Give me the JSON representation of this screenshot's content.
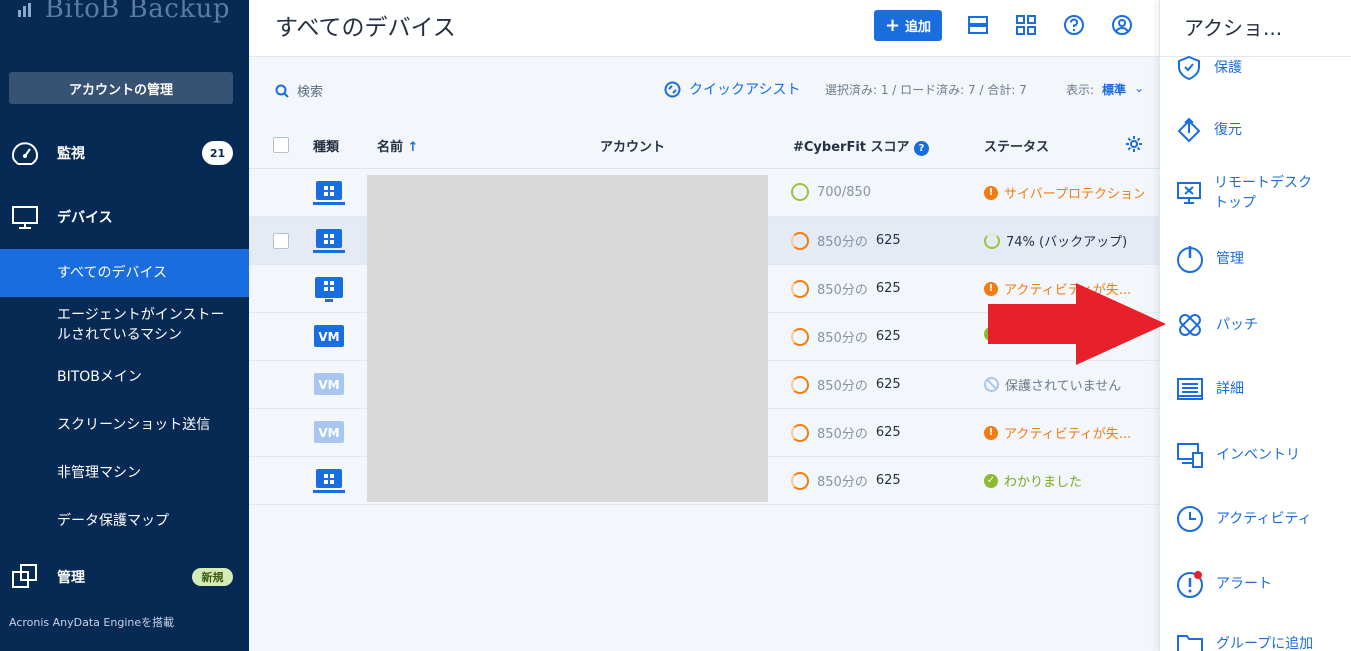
{
  "sidebar": {
    "logo": "BitoB Backup",
    "account_button": "アカウントの管理",
    "monitor": {
      "label": "監視",
      "badge": "21"
    },
    "devices": {
      "label": "デバイス"
    },
    "sub_items": [
      {
        "label": "すべてのデバイス",
        "active": true
      },
      {
        "label": "エージェントがインストールされているマシン"
      },
      {
        "label": "BITOBメイン"
      },
      {
        "label": "スクリーンショット送信"
      },
      {
        "label": "非管理マシン"
      },
      {
        "label": "データ保護マップ"
      }
    ],
    "management": {
      "label": "管理",
      "badge": "新規"
    },
    "footer": "Acronis AnyData Engineを搭載"
  },
  "header": {
    "title": "すべてのデバイス",
    "add_label": "追加"
  },
  "toolbar": {
    "search_label": "検索",
    "quick_assist": "クイックアシスト",
    "selection_info": "選択済み: 1 / ロード済み: 7 / 合計: 7",
    "view_label": "表示:",
    "view_value": "標準"
  },
  "table": {
    "headers": {
      "type": "種類",
      "name": "名前",
      "account": "アカウント",
      "score": "#CyberFit スコア",
      "status": "ステータス"
    },
    "rows": [
      {
        "type": "pc",
        "score_prefix": "700/850",
        "score_value": "",
        "status": "サイバープロテクション...",
        "status_kind": "warning"
      },
      {
        "type": "pc",
        "score_prefix": "850分の",
        "score_value": "625",
        "status": "74% (バックアップ)",
        "status_kind": "progress",
        "selected": true
      },
      {
        "type": "server",
        "score_prefix": "850分の",
        "score_value": "625",
        "status": "アクティビティが失...",
        "status_kind": "warning"
      },
      {
        "type": "vm",
        "score_prefix": "850分の",
        "score_value": "625",
        "status": "",
        "status_kind": "ok-hidden"
      },
      {
        "type": "vm-faded",
        "score_prefix": "850分の",
        "score_value": "625",
        "status": "保護されていません",
        "status_kind": "none"
      },
      {
        "type": "vm-faded",
        "score_prefix": "850分の",
        "score_value": "625",
        "status": "アクティビティが失...",
        "status_kind": "warning"
      },
      {
        "type": "pc",
        "score_prefix": "850分の",
        "score_value": "625",
        "status": "わかりました",
        "status_kind": "ok"
      }
    ]
  },
  "panel": {
    "title": "アクショ...",
    "items": [
      {
        "label": "保護",
        "icon": "shield-icon"
      },
      {
        "label": "復元",
        "icon": "restore-icon"
      },
      {
        "label": "リモートデスクトップ",
        "icon": "remote-desktop-icon"
      },
      {
        "label": "管理",
        "icon": "power-icon"
      },
      {
        "label": "パッチ",
        "icon": "patch-icon"
      },
      {
        "label": "詳細",
        "icon": "details-icon"
      },
      {
        "label": "インベントリ",
        "icon": "inventory-icon"
      },
      {
        "label": "アクティビティ",
        "icon": "clock-icon"
      },
      {
        "label": "アラート",
        "icon": "alert-icon"
      },
      {
        "label": "グループに追加",
        "icon": "folder-icon"
      }
    ]
  },
  "colors": {
    "sidebar": "#072a55",
    "accent": "#1a6ddf",
    "warning": "#f07d12",
    "ok": "#8bbb2e",
    "arrow": "#e8202a"
  }
}
